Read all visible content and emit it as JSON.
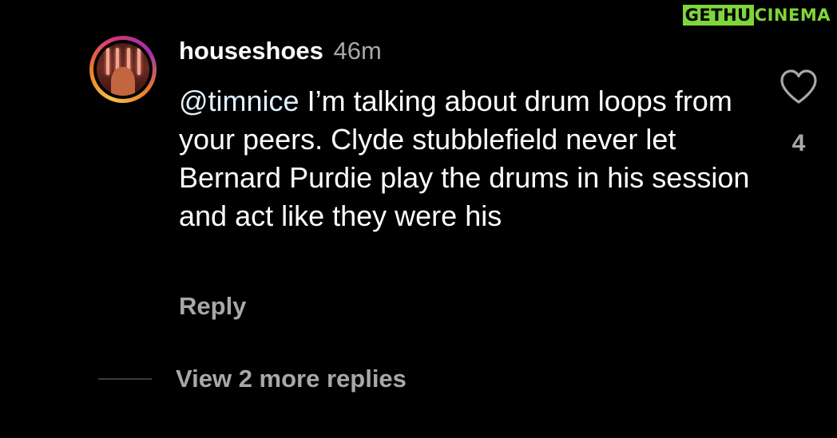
{
  "watermark": {
    "part1": "GETHU",
    "part2": "CINEMA",
    "color": "#7fd63a"
  },
  "comment": {
    "username": "houseshoes",
    "time": "46m",
    "mention": "@timnice",
    "text": " I’m talking about drum loops from your peers. Clyde stubblefield never let Bernard Purdie play the drums in his session and act like they were his",
    "reply_label": "Reply",
    "like_icon": "heart-outline-icon",
    "like_count": "4"
  },
  "replies": {
    "view_more_label": "View 2 more replies"
  },
  "colors": {
    "background": "#000000",
    "primary_text": "#ffffff",
    "secondary_text": "#a8a8a8"
  }
}
